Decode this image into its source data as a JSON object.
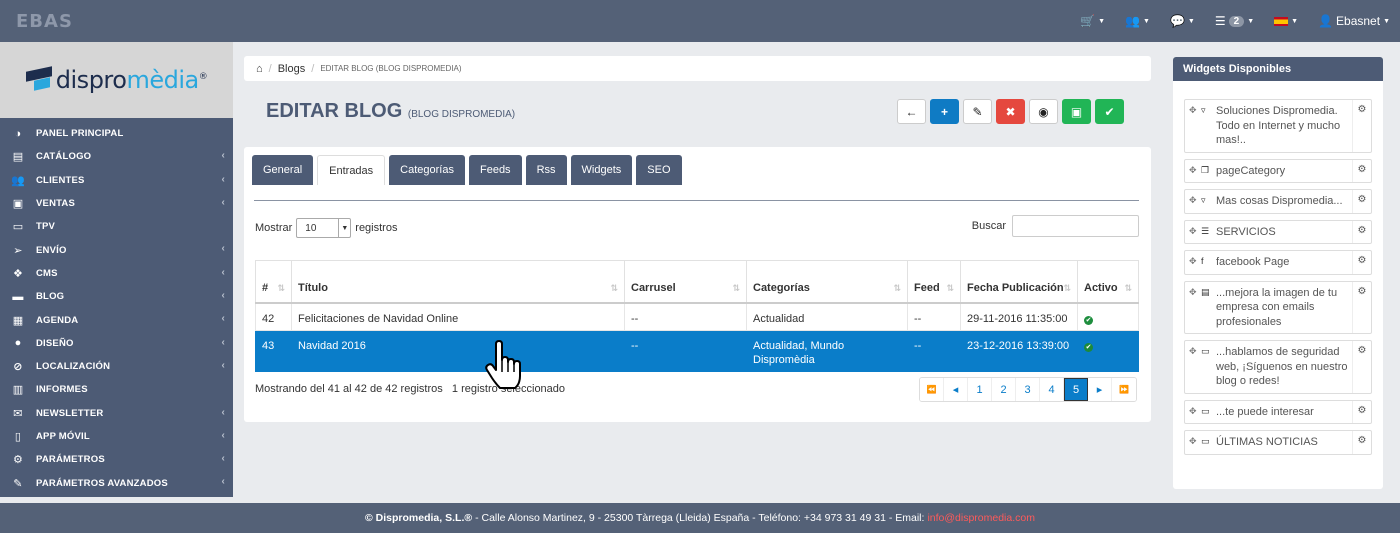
{
  "topbar": {
    "logo": "EBAS",
    "nav": [
      {
        "icon": "cart-icon",
        "glyph": "🛒"
      },
      {
        "icon": "users-icon",
        "glyph": "👥"
      },
      {
        "icon": "chat-icon",
        "glyph": "💬"
      },
      {
        "icon": "list-icon",
        "glyph": "☰",
        "badge": "2"
      },
      {
        "icon": "flag-spain-icon"
      },
      {
        "icon": "user-icon",
        "glyph": "👤",
        "label": "Ebasnet"
      }
    ]
  },
  "sidebar": {
    "brand_pre": "dispro",
    "brand_post": "mèdia",
    "brand_mark": "®",
    "items": [
      {
        "label": "PANEL PRINCIPAL",
        "icon": "dashboard-icon",
        "glyph": "◑",
        "chevron": false
      },
      {
        "label": "CATÁLOGO",
        "icon": "archive-icon",
        "glyph": "▤",
        "chevron": true
      },
      {
        "label": "CLIENTES",
        "icon": "users-icon",
        "glyph": "👥",
        "chevron": true
      },
      {
        "label": "VENTAS",
        "icon": "money-icon",
        "glyph": "▣",
        "chevron": true
      },
      {
        "label": "TPV",
        "icon": "card-icon",
        "glyph": "▭",
        "chevron": false
      },
      {
        "label": "ENVÍO",
        "icon": "send-icon",
        "glyph": "➢",
        "chevron": true
      },
      {
        "label": "CMS",
        "icon": "cubes-icon",
        "glyph": "❖",
        "chevron": true
      },
      {
        "label": "BLOG",
        "icon": "keyboard-icon",
        "glyph": "▬",
        "chevron": true
      },
      {
        "label": "AGENDA",
        "icon": "calendar-icon",
        "glyph": "▦",
        "chevron": true
      },
      {
        "label": "DISEÑO",
        "icon": "tint-icon",
        "glyph": "●",
        "chevron": true
      },
      {
        "label": "LOCALIZACIÓN",
        "icon": "compass-icon",
        "glyph": "⊘",
        "chevron": true
      },
      {
        "label": "INFORMES",
        "icon": "bar-chart-icon",
        "glyph": "▥",
        "chevron": false
      },
      {
        "label": "NEWSLETTER",
        "icon": "envelope-icon",
        "glyph": "✉",
        "chevron": true
      },
      {
        "label": "APP MÓVIL",
        "icon": "mobile-icon",
        "glyph": "▯",
        "chevron": true
      },
      {
        "label": "PARÁMETROS",
        "icon": "cogs-icon",
        "glyph": "⚙",
        "chevron": true
      },
      {
        "label": "PARÁMETROS AVANZADOS",
        "icon": "wrench-icon",
        "glyph": "✎",
        "chevron": true
      }
    ]
  },
  "breadcrumb": {
    "home_glyph": "⌂",
    "blogs": "Blogs",
    "current": "EDITAR BLOG (BLOG DISPROMEDIA)"
  },
  "page": {
    "title": "EDITAR BLOG",
    "subtitle": "(BLOG DISPROMEDIA)"
  },
  "actions": [
    {
      "name": "back-button",
      "icon": "arrow-left-icon",
      "glyph": "←",
      "style": ""
    },
    {
      "name": "add-button",
      "icon": "plus-icon",
      "glyph": "+",
      "style": "blue"
    },
    {
      "name": "edit-button",
      "icon": "pencil-icon",
      "glyph": "✎",
      "style": ""
    },
    {
      "name": "delete-button",
      "icon": "close-icon",
      "glyph": "✖",
      "style": "red"
    },
    {
      "name": "view-button",
      "icon": "eye-icon",
      "glyph": "◉",
      "style": ""
    },
    {
      "name": "save-button",
      "icon": "save-icon",
      "glyph": "▣",
      "style": "green"
    },
    {
      "name": "confirm-button",
      "icon": "check-icon",
      "glyph": "✔",
      "style": "green"
    }
  ],
  "tabs": [
    {
      "label": "General",
      "active": false
    },
    {
      "label": "Entradas",
      "active": true
    },
    {
      "label": "Categorías",
      "active": false
    },
    {
      "label": "Feeds",
      "active": false
    },
    {
      "label": "Rss",
      "active": false
    },
    {
      "label": "Widgets",
      "active": false
    },
    {
      "label": "SEO",
      "active": false
    }
  ],
  "table_controls": {
    "show_label": "Mostrar",
    "show_value": "10",
    "records_label": "registros",
    "search_label": "Buscar",
    "search_value": ""
  },
  "table": {
    "columns": [
      "#",
      "Título",
      "Carrusel",
      "Categorías",
      "Feed",
      "Fecha Publicación",
      "Activo"
    ],
    "rows": [
      {
        "id": "42",
        "title": "Felicitaciones de Navidad Online",
        "carousel": "--",
        "categories": "Actualidad",
        "feed": "--",
        "date": "29-11-2016 11:35:00",
        "active": true,
        "selected": false
      },
      {
        "id": "43",
        "title": "Navidad 2016",
        "carousel": "--",
        "categories": "Actualidad, Mundo Dispromèdia",
        "feed": "--",
        "date": "23-12-2016 13:39:00",
        "active": true,
        "selected": true
      }
    ],
    "info": "Mostrando del 41 al 42 de 42 registros",
    "selection_info": "1 registro seleccionado"
  },
  "pagination": {
    "first": "⏪",
    "prev": "◂",
    "pages": [
      "1",
      "2",
      "3",
      "4",
      "5"
    ],
    "current": "5",
    "next": "▸",
    "last": "⏩"
  },
  "widgets": {
    "title": "Widgets Disponibles",
    "items": [
      {
        "icon": "html5-icon",
        "glyph": "▿",
        "label": "Soluciones Dispromedia. Todo en Internet y mucho mas!.."
      },
      {
        "icon": "copy-icon",
        "glyph": "❐",
        "label": "pageCategory"
      },
      {
        "icon": "html5-icon",
        "glyph": "▿",
        "label": "Mas cosas Dispromedia..."
      },
      {
        "icon": "list-icon",
        "glyph": "☰",
        "label": "SERVICIOS"
      },
      {
        "icon": "facebook-icon",
        "glyph": "f",
        "label": "facebook Page"
      },
      {
        "icon": "newspaper-icon",
        "glyph": "▤",
        "label": "...mejora la imagen de tu empresa con emails profesionales"
      },
      {
        "icon": "folder-icon",
        "glyph": "▭",
        "label": "...hablamos de seguridad web, ¡Síguenos en nuestro blog o redes!"
      },
      {
        "icon": "folder-icon",
        "glyph": "▭",
        "label": "...te puede interesar"
      },
      {
        "icon": "folder-icon",
        "glyph": "▭",
        "label": "ÚLTIMAS NOTICIAS"
      }
    ]
  },
  "footer": {
    "company": "© Dispromedia, S.L.®",
    "address": "- Calle Alonso Martinez, 9 - 25300 Tàrrega (Lleida) España - Teléfono: +34 973 31 49 31 - Email:",
    "email": "info@dispromedia.com"
  }
}
